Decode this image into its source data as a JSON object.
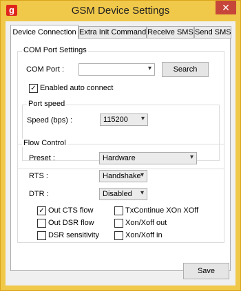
{
  "window": {
    "title": "GSM Device Settings",
    "app_icon_letter": "g",
    "close_glyph": "✕"
  },
  "tabs": [
    {
      "label": "Device Connection",
      "active": true
    },
    {
      "label": "Extra Init Command",
      "active": false
    },
    {
      "label": "Receive SMS",
      "active": false
    },
    {
      "label": "Send SMS",
      "active": false
    }
  ],
  "com_port_settings": {
    "legend": "COM Port Settings",
    "com_port_label": "COM Port :",
    "com_port_value": "",
    "search_button": "Search",
    "auto_connect_label": "Enabled auto connect",
    "auto_connect_checked": true,
    "port_speed": {
      "legend": "Port speed",
      "speed_label": "Speed (bps) :",
      "speed_value": "115200"
    }
  },
  "flow_control": {
    "legend": "Flow Control",
    "preset_label": "Preset :",
    "preset_value": "Hardware",
    "rts_label": "RTS :",
    "rts_value": "Handshake",
    "dtr_label": "DTR :",
    "dtr_value": "Disabled",
    "checkboxes": [
      {
        "label": "Out CTS flow",
        "checked": true
      },
      {
        "label": "TxContinue XOn XOff",
        "checked": false
      },
      {
        "label": "Out DSR flow",
        "checked": false
      },
      {
        "label": "Xon/Xoff out",
        "checked": false
      },
      {
        "label": "DSR sensitivity",
        "checked": false
      },
      {
        "label": "Xon/Xoff in",
        "checked": false
      }
    ]
  },
  "footer": {
    "save_button": "Save"
  },
  "icons": {
    "dropdown": "chevron-down-icon",
    "check": "checkmark-icon"
  },
  "colors": {
    "title_bar": "#f0c84a",
    "app_icon": "#e0261c",
    "close_button": "#c7463a"
  }
}
